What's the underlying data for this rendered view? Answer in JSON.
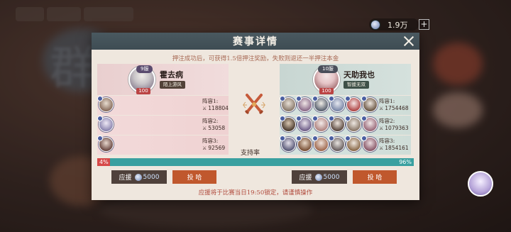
{
  "currency": {
    "value": "1.9万",
    "plus": "+",
    "icon": "coin-icon"
  },
  "modal": {
    "title": "赛事详情",
    "notice": "押注成功后，可获得1.5倍押注奖励，失败则退还一半押注本金",
    "support_label": "支持率",
    "footer_note": "应援将于比赛当日19:50锁定，请谨慎操作"
  },
  "left_team": {
    "server": "9服",
    "level": "100",
    "name": "霍去病",
    "guild": "陌上游风",
    "lineups": [
      {
        "label": "阵容1:",
        "power": "118804",
        "heroes": 1
      },
      {
        "label": "阵容2:",
        "power": "53058",
        "heroes": 1
      },
      {
        "label": "阵容3:",
        "power": "92569",
        "heroes": 1
      }
    ],
    "support_pct": "4%",
    "support_fraction": 0.04,
    "support_button": "应援",
    "support_amount": "5000",
    "join_button": "投 哈"
  },
  "right_team": {
    "server": "10服",
    "level": "100",
    "name": "天助我也",
    "guild": "智援无双",
    "lineups": [
      {
        "label": "阵容1:",
        "power": "1754468",
        "heroes": 6
      },
      {
        "label": "阵容2:",
        "power": "1079363",
        "heroes": 6
      },
      {
        "label": "阵容3:",
        "power": "1854161",
        "heroes": 6
      }
    ],
    "support_pct": "96%",
    "support_button": "应援",
    "support_amount": "5000",
    "join_button": "投 哈"
  },
  "colors": {
    "left_bar": "#d64848",
    "right_bar": "#3aa0a0",
    "header": "#4a5960",
    "join_btn": "#c0582d"
  }
}
